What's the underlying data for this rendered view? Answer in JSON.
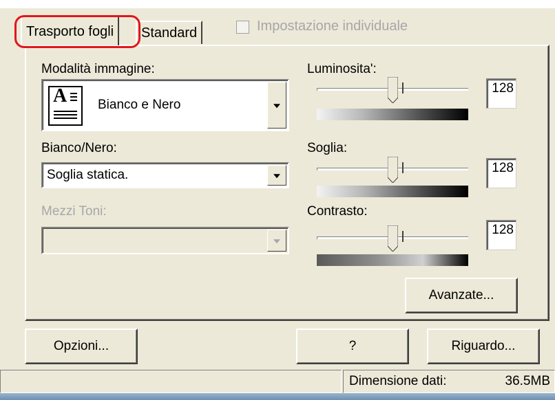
{
  "tabs": [
    {
      "label": "Trasporto fogli",
      "active": true
    },
    {
      "label": "Standard",
      "active": false
    }
  ],
  "individual_setting": {
    "label": "Impostazione individuale",
    "checked": false,
    "enabled": false
  },
  "image_mode": {
    "label": "Modalità immagine:",
    "value": "Bianco e Nero",
    "icon": "text-document-icon"
  },
  "black_white": {
    "label": "Bianco/Nero:",
    "value": "Soglia statica."
  },
  "halftone": {
    "label": "Mezzi Toni:",
    "value": "",
    "enabled": false
  },
  "brightness": {
    "label": "Luminosita':",
    "value": "128"
  },
  "threshold": {
    "label": "Soglia:",
    "value": "128"
  },
  "contrast": {
    "label": "Contrasto:",
    "value": "128"
  },
  "buttons": {
    "advanced": "Avanzate...",
    "options": "Opzioni...",
    "help": "?",
    "preview": "Riguardo..."
  },
  "status": {
    "data_size_label": "Dimensione dati:",
    "data_size_value": "36.5MB"
  },
  "colors": {
    "highlight": "#e0161d",
    "dialog_bg": "#ece9d8"
  }
}
